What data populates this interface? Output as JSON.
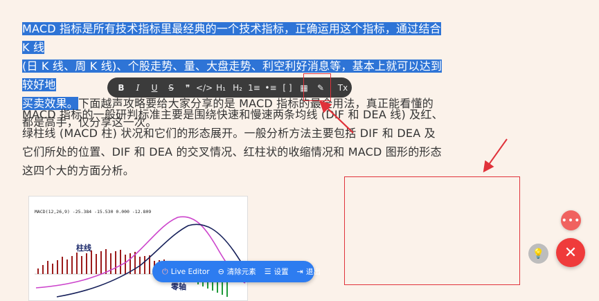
{
  "article": {
    "p1_highlighted_1": "MACD 指标是所有技术指标里最经典的一个技术指标，正确运用这个指标，通过结合 K 线",
    "p1_highlighted_2": "(日 K 线、周 K 线)、个股走势、量、大盘走势、利空利好消息等，基本上就可以达到较好地",
    "p1_highlighted_3": "买卖效果。",
    "p1_rest": "下面越声攻略要给大家分享的是 MACD 指标的最全用法，真正能看懂的都是高手，仅分享这一次。",
    "p2": "MACD 指标的一般研判标准主要是围绕快速和慢速两条均线 (DIF 和 DEA 线) 及红、绿柱线 (MACD 柱) 状况和它们的形态展开。一般分析方法主要包括 DIF 和 DEA 及它们所处的位置、DIF 和 DEA 的交叉情况、红柱状的收缩情况和 MACD 图形的形态这四个大的方面分析。"
  },
  "toolbar": {
    "bold": "B",
    "italic": "I",
    "underline": "U",
    "strike": "S",
    "quote": "❞",
    "code": "</>",
    "h1": "H₁",
    "h2": "H₂",
    "ordered_list": "1≡",
    "bullet_list": "•≡",
    "code_block": "[ ]",
    "table": "▦",
    "highlight": "✎",
    "clear_format": "Tx"
  },
  "chart": {
    "caption": "MACD(12,26,9) -25.384 -15.530 0.000 -12.809",
    "bar_label": "柱线",
    "zero_label": "零轴"
  },
  "editor_bar": {
    "live_editor": "Live Editor",
    "clear": "清除元素",
    "settings": "设置",
    "exit": "退出"
  },
  "colors": {
    "highlight": "#2e74d6",
    "annotation": "#e0323a",
    "editor_bar": "#2d7cf0",
    "fab": "#ef3b3b"
  }
}
